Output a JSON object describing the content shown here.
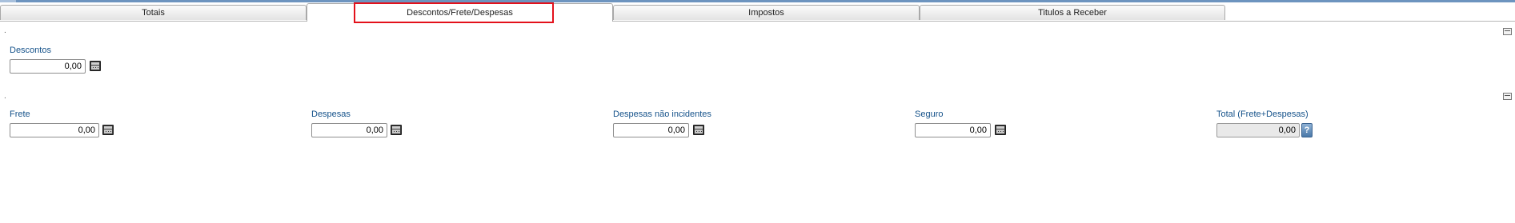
{
  "tabs": [
    {
      "label": "Totais"
    },
    {
      "label": "Descontos/Frete/Despesas"
    },
    {
      "label": "Impostos"
    },
    {
      "label": "Titulos a Receber"
    }
  ],
  "sections": {
    "descontos": {
      "marker": ".",
      "fields": {
        "descontos": {
          "label": "Descontos",
          "value": "0,00"
        }
      }
    },
    "frete_despesas": {
      "marker": ".",
      "fields": {
        "frete": {
          "label": "Frete",
          "value": "0,00"
        },
        "despesas": {
          "label": "Despesas",
          "value": "0,00"
        },
        "despesas_nao_incidentes": {
          "label": "Despesas não incidentes",
          "value": "0,00"
        },
        "seguro": {
          "label": "Seguro",
          "value": "0,00"
        },
        "total": {
          "label": "Total (Frete+Despesas)",
          "value": "0,00"
        }
      }
    }
  },
  "icons": {
    "calculator": "calculator-icon",
    "help": "?",
    "collapse": "collapse-icon"
  },
  "colors": {
    "label": "#15528a",
    "highlight": "#e3111b"
  }
}
